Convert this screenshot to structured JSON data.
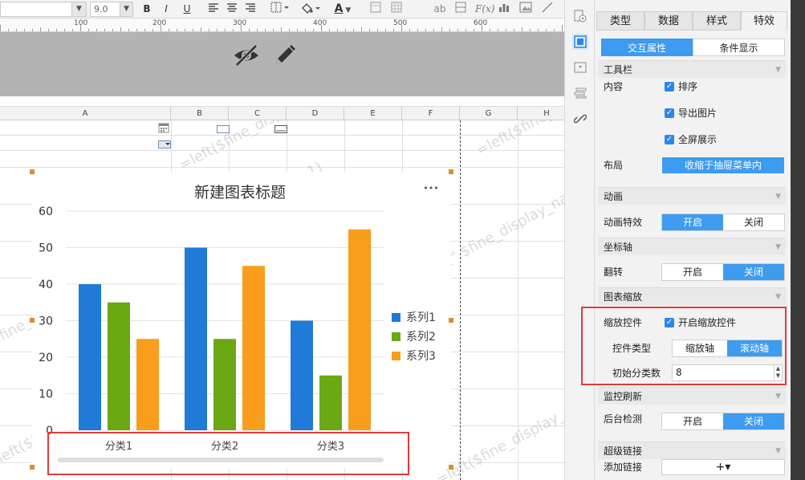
{
  "toolbar": {
    "font_name": "",
    "font_size": "9.0",
    "bold": "B",
    "italic": "I",
    "underline": "U",
    "text_color_glyph": "A",
    "text_preview": "ab",
    "formula_glyph": "F(x)"
  },
  "ruler": {
    "labels": [
      "100",
      "200",
      "300",
      "400",
      "500",
      "600"
    ]
  },
  "columns": [
    "A",
    "B",
    "C",
    "D",
    "E",
    "F",
    "G",
    "H"
  ],
  "watermark_text": "=left($fine_display_name,find(\"(\",$fine_display_name)-1)",
  "chart_data": {
    "type": "bar",
    "title": "新建图表标题",
    "categories": [
      "分类1",
      "分类2",
      "分类3"
    ],
    "series": [
      {
        "name": "系列1",
        "color": "#1f7ad8",
        "values": [
          40,
          50,
          30
        ]
      },
      {
        "name": "系列2",
        "color": "#6aa814",
        "values": [
          35,
          25,
          15
        ]
      },
      {
        "name": "系列3",
        "color": "#f99d1c",
        "values": [
          25,
          45,
          55
        ]
      }
    ],
    "ylim": [
      0,
      60
    ],
    "yticks": [
      0,
      10,
      20,
      30,
      40,
      50,
      60
    ],
    "grid": true,
    "legend_position": "right",
    "more_glyph": "•••"
  },
  "panel": {
    "tabs": [
      "类型",
      "数据",
      "样式",
      "特效"
    ],
    "selected_tab": "特效",
    "subtabs": [
      "交互属性",
      "条件显示"
    ],
    "sections": {
      "toolbar": {
        "title": "工具栏",
        "content_label": "内容",
        "checks": [
          "排序",
          "导出图片",
          "全屏展示"
        ],
        "layout_label": "布局",
        "layout_value": "收缩于抽屉菜单内"
      },
      "animation": {
        "title": "动画",
        "label": "动画特效",
        "on": "开启",
        "off": "关闭",
        "selected": "on"
      },
      "axis": {
        "title": "坐标轴",
        "label": "翻转",
        "on": "开启",
        "off": "关闭",
        "selected": "off"
      },
      "zoom": {
        "title": "图表缩放",
        "control_label": "缩放控件",
        "control_check": "开启缩放控件",
        "type_label": "控件类型",
        "type_a": "缩放轴",
        "type_b": "滚动轴",
        "type_selected": "b",
        "initial_label": "初始分类数",
        "initial_value": "8"
      },
      "monitor": {
        "title": "监控刷新",
        "label": "后台检测",
        "on": "开启",
        "off": "关闭",
        "selected": "off"
      },
      "hyperlink": {
        "title": "超级链接",
        "label": "添加链接",
        "add_glyph": "+▾"
      }
    }
  }
}
